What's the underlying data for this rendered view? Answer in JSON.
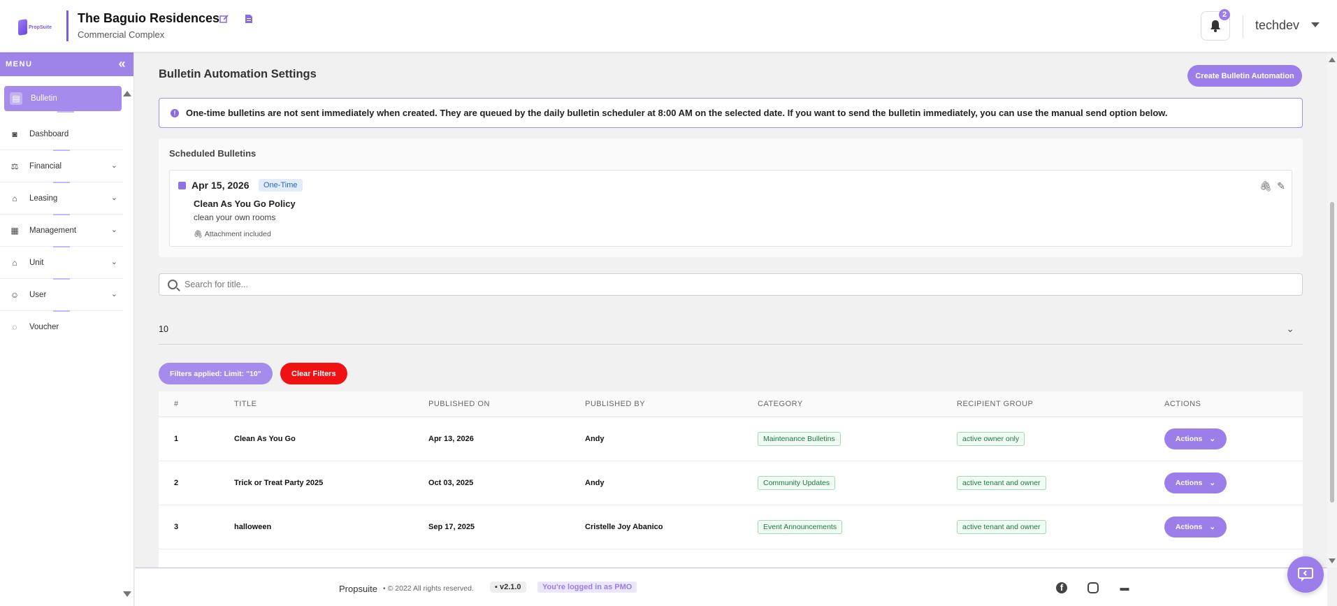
{
  "header": {
    "property_name": "The Baguio Residences",
    "property_type": "Commercial Complex",
    "logo_text": "PropSuite",
    "notification_count": "2",
    "username": "techdev"
  },
  "sidebar": {
    "menu_label": "MENU",
    "items": [
      {
        "label": "Bulletin",
        "icon": "bulletin-icon",
        "active": true
      },
      {
        "label": "Dashboard",
        "icon": "dashboard-icon"
      },
      {
        "label": "Financial",
        "icon": "financial-icon",
        "expandable": true
      },
      {
        "label": "Leasing",
        "icon": "leasing-icon",
        "expandable": true
      },
      {
        "label": "Management",
        "icon": "management-icon",
        "expandable": true
      },
      {
        "label": "Unit",
        "icon": "unit-icon",
        "expandable": true
      },
      {
        "label": "User",
        "icon": "user-icon",
        "expandable": true
      },
      {
        "label": "Voucher",
        "icon": "voucher-icon"
      }
    ]
  },
  "page": {
    "title": "Bulletin Automation Settings",
    "create_button": "Create Bulletin Automation",
    "alert": "One-time bulletins are not sent immediately when created. They are queued by the daily bulletin scheduler at 8:00 AM on the selected date. If you want to send the bulletin immediately, you can use the manual send option below."
  },
  "scheduled": {
    "title": "Scheduled Bulletins",
    "items": [
      {
        "date": "Apr 15, 2026",
        "badge": "One-Time",
        "name": "Clean As You Go Policy",
        "description": "clean your own rooms",
        "attachment": "Attachment included"
      }
    ]
  },
  "search": {
    "placeholder": "Search for title..."
  },
  "limit": {
    "value": "10"
  },
  "filters": {
    "applied_label": "Filters applied:   Limit: \"10\"",
    "clear_label": "Clear Filters"
  },
  "table": {
    "headers": [
      "#",
      "TITLE",
      "PUBLISHED ON",
      "PUBLISHED BY",
      "CATEGORY",
      "RECIPIENT GROUP",
      "ACTIONS"
    ],
    "action_label": "Actions",
    "rows": [
      {
        "num": "1",
        "title": "Clean As You Go",
        "published_on": "Apr 13, 2026",
        "published_by": "Andy",
        "category": "Maintenance Bulletins",
        "recipient": "active owner only"
      },
      {
        "num": "2",
        "title": "Trick or Treat Party 2025",
        "published_on": "Oct 03, 2025",
        "published_by": "Andy",
        "category": "Community Updates",
        "recipient": "active tenant and owner"
      },
      {
        "num": "3",
        "title": "halloween",
        "published_on": "Sep 17, 2025",
        "published_by": "Cristelle Joy Abanico",
        "category": "Event Announcements",
        "recipient": "active tenant and owner"
      }
    ]
  },
  "footer": {
    "brand": "Propsuite",
    "copyright": "© 2022 All rights reserved.",
    "version": "v2.1.0",
    "login_status": "You're logged in as PMO"
  },
  "colors": {
    "accent": "#9c7eea",
    "danger": "#f01212",
    "tag_green": "#1c7a3e"
  }
}
